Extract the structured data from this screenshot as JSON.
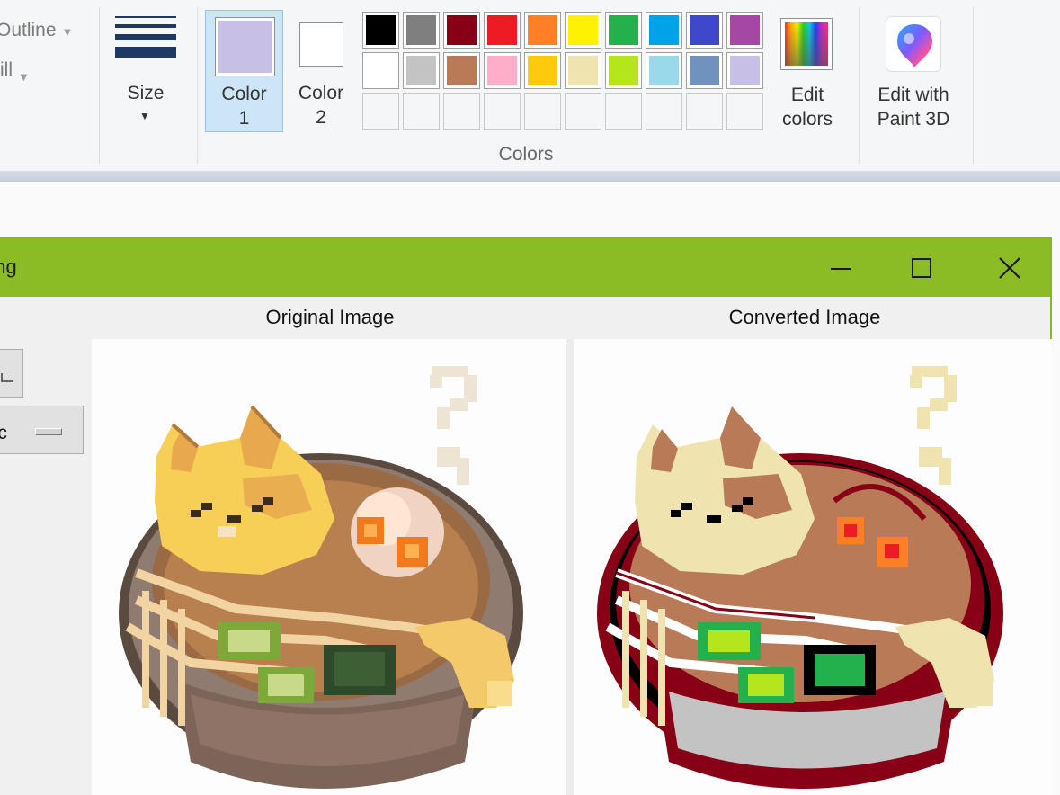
{
  "ribbon": {
    "outline_label": "Outline",
    "fill_label": "Fill",
    "size_label": "Size",
    "color1_label": "Color\n1",
    "color1_line1": "Color",
    "color1_line2": "1",
    "color2_line1": "Color",
    "color2_line2": "2",
    "color1_value": "#c8bfe7",
    "color2_value": "#ffffff",
    "colors_group_label": "Colors",
    "edit_colors_line1": "Edit",
    "edit_colors_line2": "colors",
    "paint3d_line1": "Edit with",
    "paint3d_line2": "Paint 3D",
    "palette_row1": [
      "#000000",
      "#7f7f7f",
      "#880015",
      "#ed1c24",
      "#ff7f27",
      "#fff200",
      "#22b14c",
      "#00a2e8",
      "#3f48cc",
      "#a349a4"
    ],
    "palette_row2": [
      "#ffffff",
      "#c3c3c3",
      "#b97a57",
      "#ffaec9",
      "#ffc90e",
      "#efe4b0",
      "#b5e61d",
      "#99d9ea",
      "#7092be",
      "#c8bfe7"
    ]
  },
  "window": {
    "title": "png",
    "original_label": "Original Image",
    "converted_label": "Converted Image",
    "side_button2": "pic",
    "accent": "#8bbc24"
  }
}
